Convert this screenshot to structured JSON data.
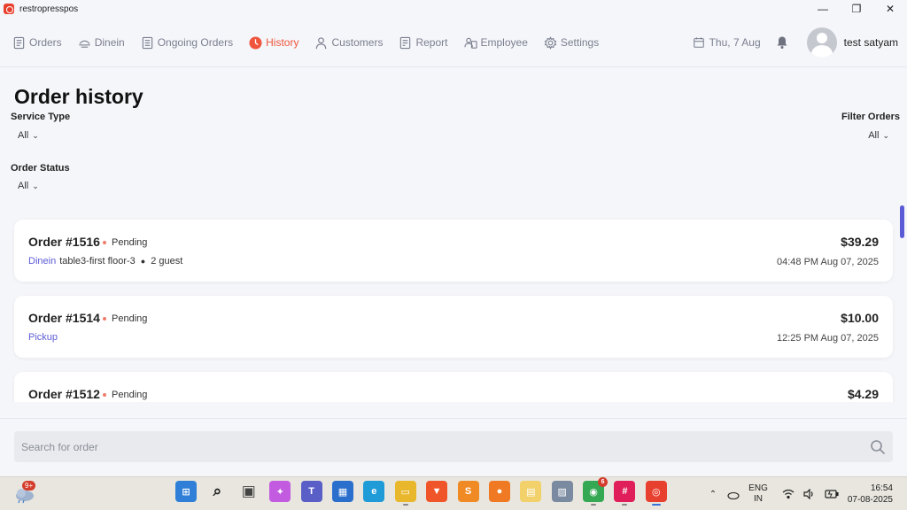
{
  "window": {
    "title": "restropresspos",
    "minimize": "—",
    "maximize": "❐",
    "close": "✕"
  },
  "nav": {
    "items": [
      {
        "label": "Orders",
        "icon": "orders-icon",
        "active": false
      },
      {
        "label": "Dinein",
        "icon": "dinein-icon",
        "active": false
      },
      {
        "label": "Ongoing Orders",
        "icon": "ongoing-orders-icon",
        "active": false
      },
      {
        "label": "History",
        "icon": "history-icon",
        "active": true
      },
      {
        "label": "Customers",
        "icon": "customers-icon",
        "active": false
      },
      {
        "label": "Report",
        "icon": "report-icon",
        "active": false
      },
      {
        "label": "Employee",
        "icon": "employee-icon",
        "active": false
      },
      {
        "label": "Settings",
        "icon": "settings-icon",
        "active": false
      }
    ],
    "date": "Thu, 7 Aug",
    "user": "test satyam"
  },
  "page": {
    "title": "Order history",
    "service_type_label": "Service Type",
    "service_type_value": "All",
    "order_status_label": "Order Status",
    "order_status_value": "All",
    "filter_orders_label": "Filter Orders",
    "filter_orders_value": "All"
  },
  "orders": [
    {
      "number": "Order #1516",
      "status": "Pending",
      "type": "Dinein",
      "table": "table3-first floor-3",
      "guests": "2 guest",
      "price": "$39.29",
      "time": "04:48 PM Aug 07, 2025"
    },
    {
      "number": "Order #1514",
      "status": "Pending",
      "type": "Pickup",
      "table": "",
      "guests": "",
      "price": "$10.00",
      "time": "12:25 PM Aug 07, 2025"
    },
    {
      "number": "Order #1512",
      "status": "Pending",
      "type": "",
      "table": "",
      "guests": "",
      "price": "$4.29",
      "time": ""
    }
  ],
  "search": {
    "placeholder": "Search for order"
  },
  "taskbar": {
    "weather_badge": "9+",
    "apps": [
      {
        "name": "windows-start-icon",
        "color": "#2f7fd8",
        "badge": ""
      },
      {
        "name": "search-icon",
        "color": "#222222",
        "badge": ""
      },
      {
        "name": "task-view-icon",
        "color": "#444444",
        "badge": ""
      },
      {
        "name": "copilot-icon",
        "color": "#c25be0",
        "badge": ""
      },
      {
        "name": "teams-icon",
        "color": "#5a5fc7",
        "badge": ""
      },
      {
        "name": "store-icon",
        "color": "#2b6fcc",
        "badge": ""
      },
      {
        "name": "edge-icon",
        "color": "#1f9bd8",
        "badge": ""
      },
      {
        "name": "file-explorer-icon",
        "color": "#e8b72c",
        "badge": ""
      },
      {
        "name": "brave-icon",
        "color": "#f0552a",
        "badge": ""
      },
      {
        "name": "sublime-icon",
        "color": "#f08a24",
        "badge": ""
      },
      {
        "name": "firefox-icon",
        "color": "#f07a24",
        "badge": ""
      },
      {
        "name": "notes-icon",
        "color": "#f2d16b",
        "badge": ""
      },
      {
        "name": "photos-icon",
        "color": "#7a8aa0",
        "badge": ""
      },
      {
        "name": "chrome-icon",
        "color": "#34a853",
        "badge": "6"
      },
      {
        "name": "slack-icon",
        "color": "#e01e5a",
        "badge": ""
      },
      {
        "name": "restropresspos-icon",
        "color": "#e8402f",
        "badge": ""
      }
    ],
    "language": "ENG",
    "region": "IN",
    "time": "16:54",
    "date": "07-08-2025"
  }
}
